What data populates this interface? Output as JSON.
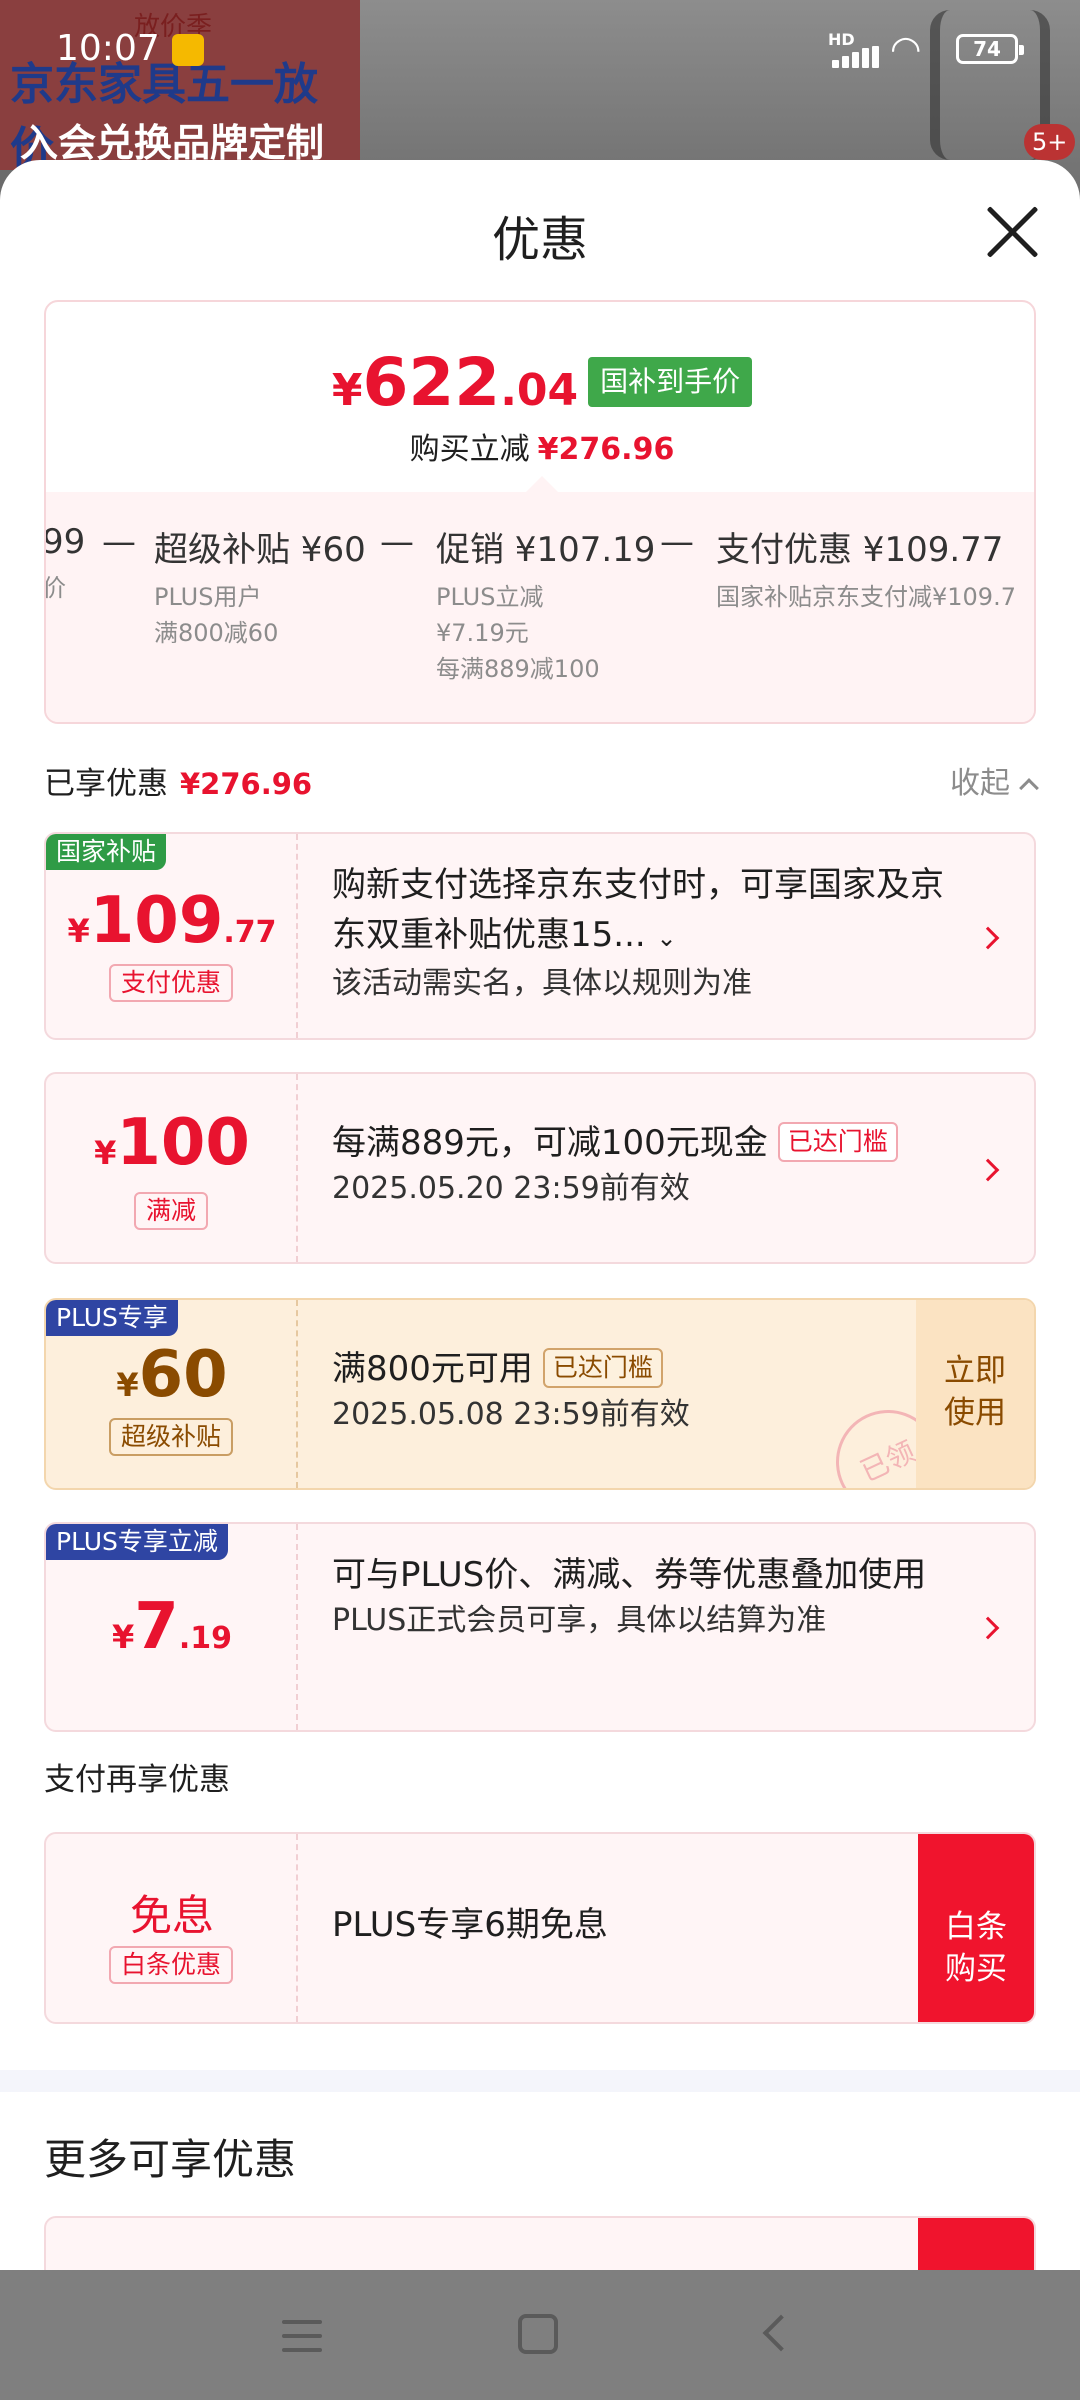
{
  "status_bar": {
    "time": "10:07",
    "hd": "HD",
    "signal_suffix": "6",
    "battery": "74"
  },
  "background": {
    "banner_tag": "放价季",
    "banner_line1": "京东家具五一放价",
    "banner_line2": "入会兑换品牌定制好礼",
    "badge": "5+"
  },
  "sheet": {
    "title": "优惠"
  },
  "summary": {
    "yen": "¥",
    "price_int": "622",
    "price_dec": ".04",
    "price_tag": "国补到手价",
    "reduce_label": "购买立减",
    "reduce_amount": "¥276.96",
    "breakdown": [
      {
        "title": "99",
        "sub": "价"
      },
      {
        "title": "超级补贴 ¥60",
        "sub": "PLUS用户\n满800减60"
      },
      {
        "title": "促销 ¥107.19",
        "sub": "PLUS立减\n¥7.19元\n每满889减100"
      },
      {
        "title": "支付优惠 ¥109.77",
        "sub": "国家补贴京东支付减¥109.7"
      }
    ],
    "minus": "—"
  },
  "applied": {
    "label": "已享优惠",
    "amount": "¥276.96",
    "collapse": "收起"
  },
  "coupons": [
    {
      "corner": "国家补贴",
      "yen": "¥",
      "num": "109",
      "dec": ".77",
      "tag": "支付优惠",
      "text": "购新支付选择京东支付时，可享国家及京东双重补贴优惠15...",
      "note": "该活动需实名，具体以规则为准"
    },
    {
      "yen": "¥",
      "num": "100",
      "tag": "满减",
      "text": "每满889元，可减100元现金",
      "reached": "已达门槛",
      "note": "2025.05.20 23:59前有效"
    },
    {
      "corner": "PLUS专享",
      "yen": "¥",
      "num": "60",
      "tag": "超级补贴",
      "text": "满800元可用",
      "reached": "已达门槛",
      "note": "2025.05.08 23:59前有效",
      "button": "立即\n使用",
      "stamp": "已领"
    },
    {
      "corner": "PLUS专享立减",
      "yen": "¥",
      "num": "7",
      "dec": ".19",
      "text": "可与PLUS价、满减、券等优惠叠加使用",
      "note": "PLUS正式会员可享，具体以结算为准"
    }
  ],
  "pay_section": {
    "label": "支付再享优惠",
    "free": "免息",
    "tag": "白条优惠",
    "text": "PLUS专享6期免息",
    "button": "白条\n购买"
  },
  "more": {
    "title": "更多可享优惠"
  }
}
